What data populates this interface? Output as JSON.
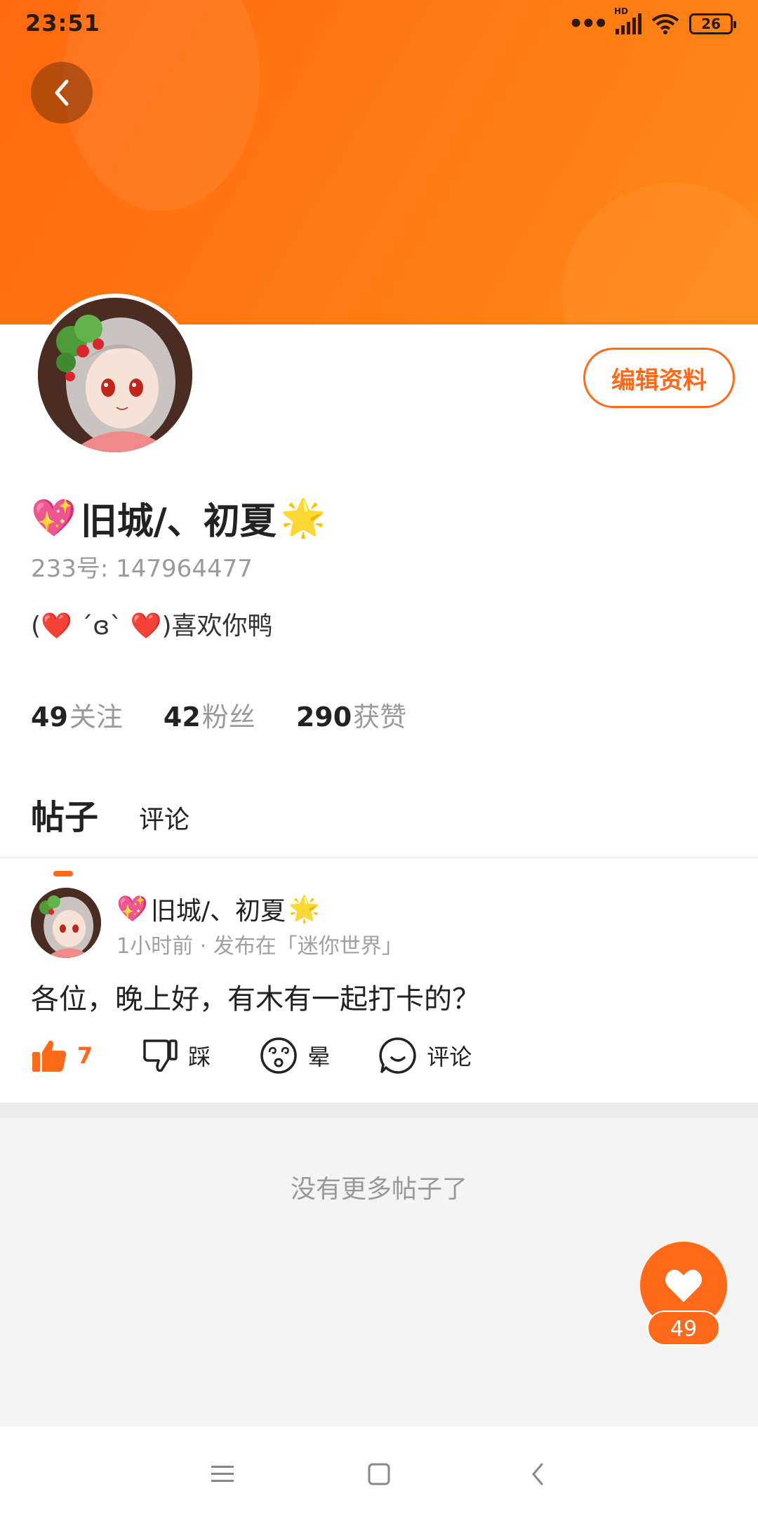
{
  "status_bar": {
    "time": "23:51",
    "network_label": "HD",
    "battery": "26"
  },
  "profile": {
    "name": "旧城/、初夏",
    "name_prefix_emoji": "💖",
    "name_suffix_emoji": "🌟",
    "uid": "233号: 147964477",
    "bio": "(❤️ ˊɞˋ ❤️)喜欢你鸭",
    "edit_label": "编辑资料",
    "stats": {
      "following_count": "49",
      "following_label": "关注",
      "followers_count": "42",
      "followers_label": "粉丝",
      "likes_count": "290",
      "likes_label": "获赞"
    }
  },
  "tabs": {
    "posts": "帖子",
    "comments": "评论"
  },
  "post": {
    "author": "旧城/、初夏",
    "author_prefix_emoji": "💖",
    "author_suffix_emoji": "🌟",
    "meta": "1小时前 · 发布在「迷你世界」",
    "text": "各位，晚上好，有木有一起打卡的？",
    "actions": {
      "like_count": "7",
      "dislike_label": "踩",
      "dizzy_label": "晕",
      "comment_label": "评论"
    }
  },
  "footer": {
    "no_more": "没有更多帖子了"
  },
  "fab": {
    "count": "49"
  },
  "colors": {
    "accent": "#ff6a1a",
    "banner": "#ff7a12"
  }
}
